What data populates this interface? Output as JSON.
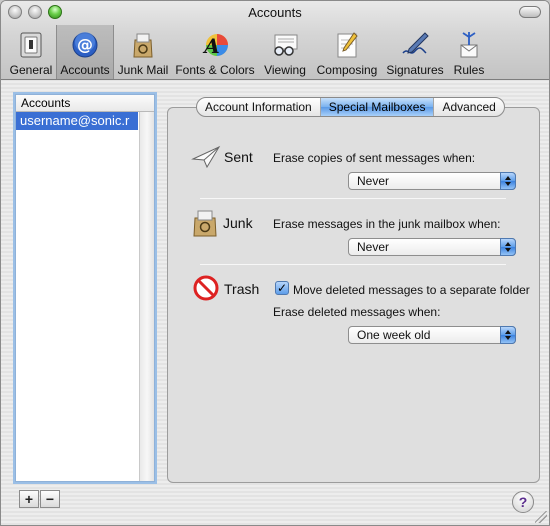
{
  "window": {
    "title": "Accounts"
  },
  "toolbar": {
    "items": [
      {
        "label": "General",
        "icon": "switch-icon"
      },
      {
        "label": "Accounts",
        "icon": "at-sign-icon"
      },
      {
        "label": "Junk Mail",
        "icon": "junk-bag-icon"
      },
      {
        "label": "Fonts & Colors",
        "icon": "font-color-icon"
      },
      {
        "label": "Viewing",
        "icon": "glasses-icon"
      },
      {
        "label": "Composing",
        "icon": "pencil-paper-icon"
      },
      {
        "label": "Signatures",
        "icon": "pen-signature-icon"
      },
      {
        "label": "Rules",
        "icon": "rules-envelope-icon"
      }
    ],
    "selected": "Accounts"
  },
  "accounts": {
    "header": "Accounts",
    "items": [
      "username@sonic.r"
    ],
    "add_label": "+",
    "remove_label": "−"
  },
  "tabs": {
    "items": [
      "Account Information",
      "Special Mailboxes",
      "Advanced"
    ],
    "selected": "Special Mailboxes"
  },
  "sent": {
    "label": "Sent",
    "description": "Erase copies of sent messages when:",
    "value": "Never"
  },
  "junk": {
    "label": "Junk",
    "description": "Erase messages in the junk mailbox when:",
    "value": "Never"
  },
  "trash": {
    "label": "Trash",
    "move_checkbox_label": "Move deleted messages to a separate folder",
    "move_checked": true,
    "description": "Erase deleted messages when:",
    "value": "One week old"
  },
  "help": {
    "label": "?"
  },
  "colors": {
    "selection": "#3a6fd4",
    "aqua_blue": "#5b9ae6"
  }
}
